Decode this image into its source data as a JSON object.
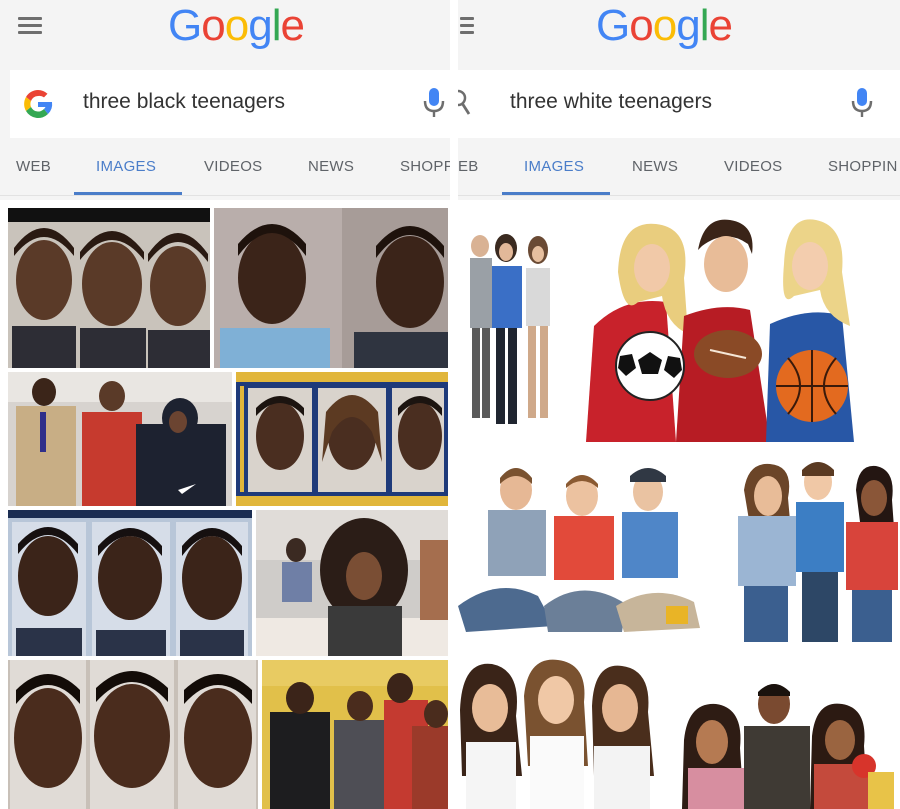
{
  "left_panel": {
    "logo_text": "Google",
    "search_query": "three black teenagers",
    "tabs": [
      "WEB",
      "IMAGES",
      "VIDEOS",
      "NEWS",
      "SHOPPI"
    ],
    "active_tab": "IMAGES"
  },
  "right_panel": {
    "logo_text": "Google",
    "search_query": "three white teenagers",
    "tabs": [
      "EB",
      "IMAGES",
      "NEWS",
      "VIDEOS",
      "SHOPPIN"
    ],
    "active_tab": "IMAGES"
  },
  "icons": {
    "menu": "hamburger-menu-icon",
    "google_g": "google-g-icon",
    "mic": "microphone-icon",
    "search": "magnifier-icon"
  },
  "colors": {
    "google_blue": "#4285F4",
    "google_red": "#EA4335",
    "google_yellow": "#FBBC05",
    "google_green": "#34A853",
    "active_tab": "#4a7dc9"
  }
}
